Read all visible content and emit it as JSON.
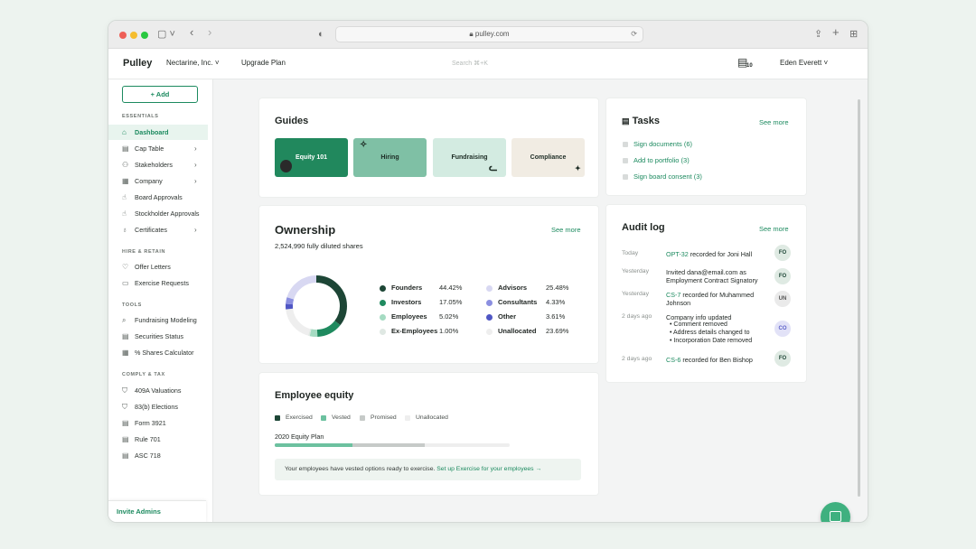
{
  "browser": {
    "url": "pulley.com"
  },
  "app": {
    "logo": "Pulley",
    "company": "Nectarine, Inc.",
    "upgrade": "Upgrade Plan",
    "search_placeholder": "Search ⌘+K",
    "calendar_badge": "10",
    "user": "Eden Everett"
  },
  "sidebar": {
    "add_button": "+ Add",
    "sections": {
      "essentials": "ESSENTIALS",
      "hire": "HIRE & RETAIN",
      "tools": "TOOLS",
      "comply": "COMPLY & TAX"
    },
    "essentials": [
      "Dashboard",
      "Cap Table",
      "Stakeholders",
      "Company",
      "Board Approvals",
      "Stockholder Approvals",
      "Certificates"
    ],
    "hire": [
      "Offer Letters",
      "Exercise Requests"
    ],
    "tools": [
      "Fundraising Modeling",
      "Securities Status",
      "% Shares Calculator"
    ],
    "comply": [
      "409A Valuations",
      "83(b) Elections",
      "Form 3921",
      "Rule 701",
      "ASC 718"
    ],
    "invite": "Invite Admins"
  },
  "guides": {
    "title": "Guides",
    "items": [
      "Equity 101",
      "Hiring",
      "Fundraising",
      "Compliance"
    ]
  },
  "tasks": {
    "title": "Tasks",
    "see_more": "See more",
    "items": [
      "Sign documents (6)",
      "Add to portfolio (3)",
      "Sign board consent (3)"
    ]
  },
  "ownership": {
    "title": "Ownership",
    "see_more": "See more",
    "subtitle": "2,524,990 fully diluted shares",
    "segments": [
      {
        "label": "Founders",
        "value": "44.42%",
        "pct": 44.42,
        "color": "#1d4636"
      },
      {
        "label": "Investors",
        "value": "17.05%",
        "pct": 17.05,
        "color": "#1f8a5f"
      },
      {
        "label": "Employees",
        "value": "5.02%",
        "pct": 5.02,
        "color": "#a5dbc2"
      },
      {
        "label": "Ex-Employees",
        "value": "1.00%",
        "pct": 1.0,
        "color": "#dfe8e3"
      },
      {
        "label": "Advisors",
        "value": "25.48%",
        "pct": 25.48,
        "color": "#d8d8f2"
      },
      {
        "label": "Consultants",
        "value": "4.33%",
        "pct": 4.33,
        "color": "#8b8fe0"
      },
      {
        "label": "Other",
        "value": "3.61%",
        "pct": 3.61,
        "color": "#4f56c4"
      },
      {
        "label": "Unallocated",
        "value": "23.69%",
        "pct": 23.69,
        "color": "#eeeeee"
      }
    ]
  },
  "audit": {
    "title": "Audit log",
    "see_more": "See more",
    "entries": [
      {
        "when": "Today",
        "link": "OPT-32",
        "text": " recorded for Joni Hall",
        "avatar": "FO"
      },
      {
        "when": "Yesterday",
        "line1": "Invited dana@email.com as",
        "line2": "Employment Contract Signatory",
        "avatar": "FO"
      },
      {
        "when": "Yesterday",
        "link": "CS-7",
        "text": " recorded for Muhammed",
        "line2": "Johnson",
        "avatar": "UN"
      },
      {
        "when": "2 days ago",
        "line1": "Company info updated",
        "bullets": [
          "Comment removed",
          "Address details changed to",
          "Incorporation Date removed"
        ],
        "avatar": "CO"
      },
      {
        "when": "2 days ago",
        "link": "CS-6",
        "text": " recorded for Ben Bishop",
        "avatar": "FO"
      }
    ]
  },
  "employee_equity": {
    "title": "Employee equity",
    "legend": [
      "Exercised",
      "Vested",
      "Promised",
      "Unallocated"
    ],
    "plan": "2020 Equity Plan",
    "vested_fraction": 0.33,
    "promised_fraction": 0.64,
    "notice": "Your employees have vested options ready to exercise. ",
    "notice_link": "Set up Exercise for your employees →"
  },
  "colors": {
    "accent": "#1c8a5f",
    "exercised": "#1d4636",
    "vested": "#6cc19f",
    "promised": "#c6cac8",
    "unallocated": "#eeeeee"
  }
}
